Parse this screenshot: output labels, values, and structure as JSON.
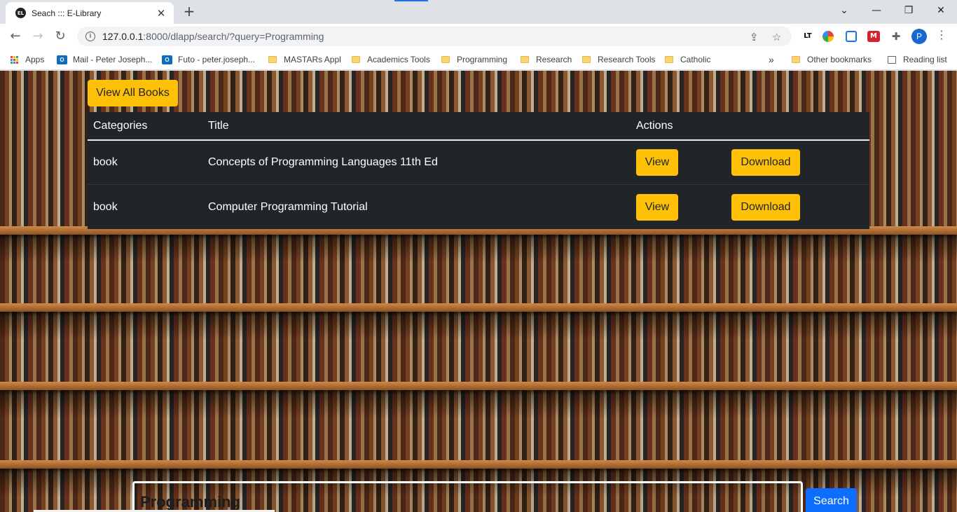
{
  "browser": {
    "tab_title": "Seach ::: E-Library",
    "url_host": "127.0.0.1",
    "url_rest": ":8000/dlapp/search/?query=Programming",
    "profile_initial": "P",
    "bookmarks": [
      {
        "label": "Apps",
        "icon": "apps-grid-icon"
      },
      {
        "label": "Mail - Peter Joseph...",
        "icon": "outlook-icon"
      },
      {
        "label": "Futo - peter.joseph...",
        "icon": "outlook-icon"
      },
      {
        "label": "MASTARs Appl",
        "icon": "folder-icon"
      },
      {
        "label": "Academics Tools",
        "icon": "folder-icon"
      },
      {
        "label": "Programming",
        "icon": "folder-icon"
      },
      {
        "label": "Research",
        "icon": "folder-icon"
      },
      {
        "label": "Research Tools",
        "icon": "folder-icon"
      },
      {
        "label": "Catholic",
        "icon": "folder-icon"
      }
    ],
    "other_bookmarks": "Other bookmarks",
    "reading_list": "Reading list",
    "overflow": "»",
    "ext_lt": "LT"
  },
  "page": {
    "view_all_label": "View All Books",
    "table": {
      "headers": {
        "category": "Categories",
        "title": "Title",
        "actions": "Actions"
      },
      "rows": [
        {
          "category": "book",
          "title": "Concepts of Programming Languages 11th Ed",
          "view": "View",
          "download": "Download"
        },
        {
          "category": "book",
          "title": "Computer Programming Tutorial",
          "view": "View",
          "download": "Download"
        }
      ]
    },
    "search": {
      "value": "Programming",
      "button": "Search"
    }
  },
  "colors": {
    "accent_yellow": "#ffc107",
    "table_bg": "#212529",
    "search_blue": "#0d6efd"
  }
}
